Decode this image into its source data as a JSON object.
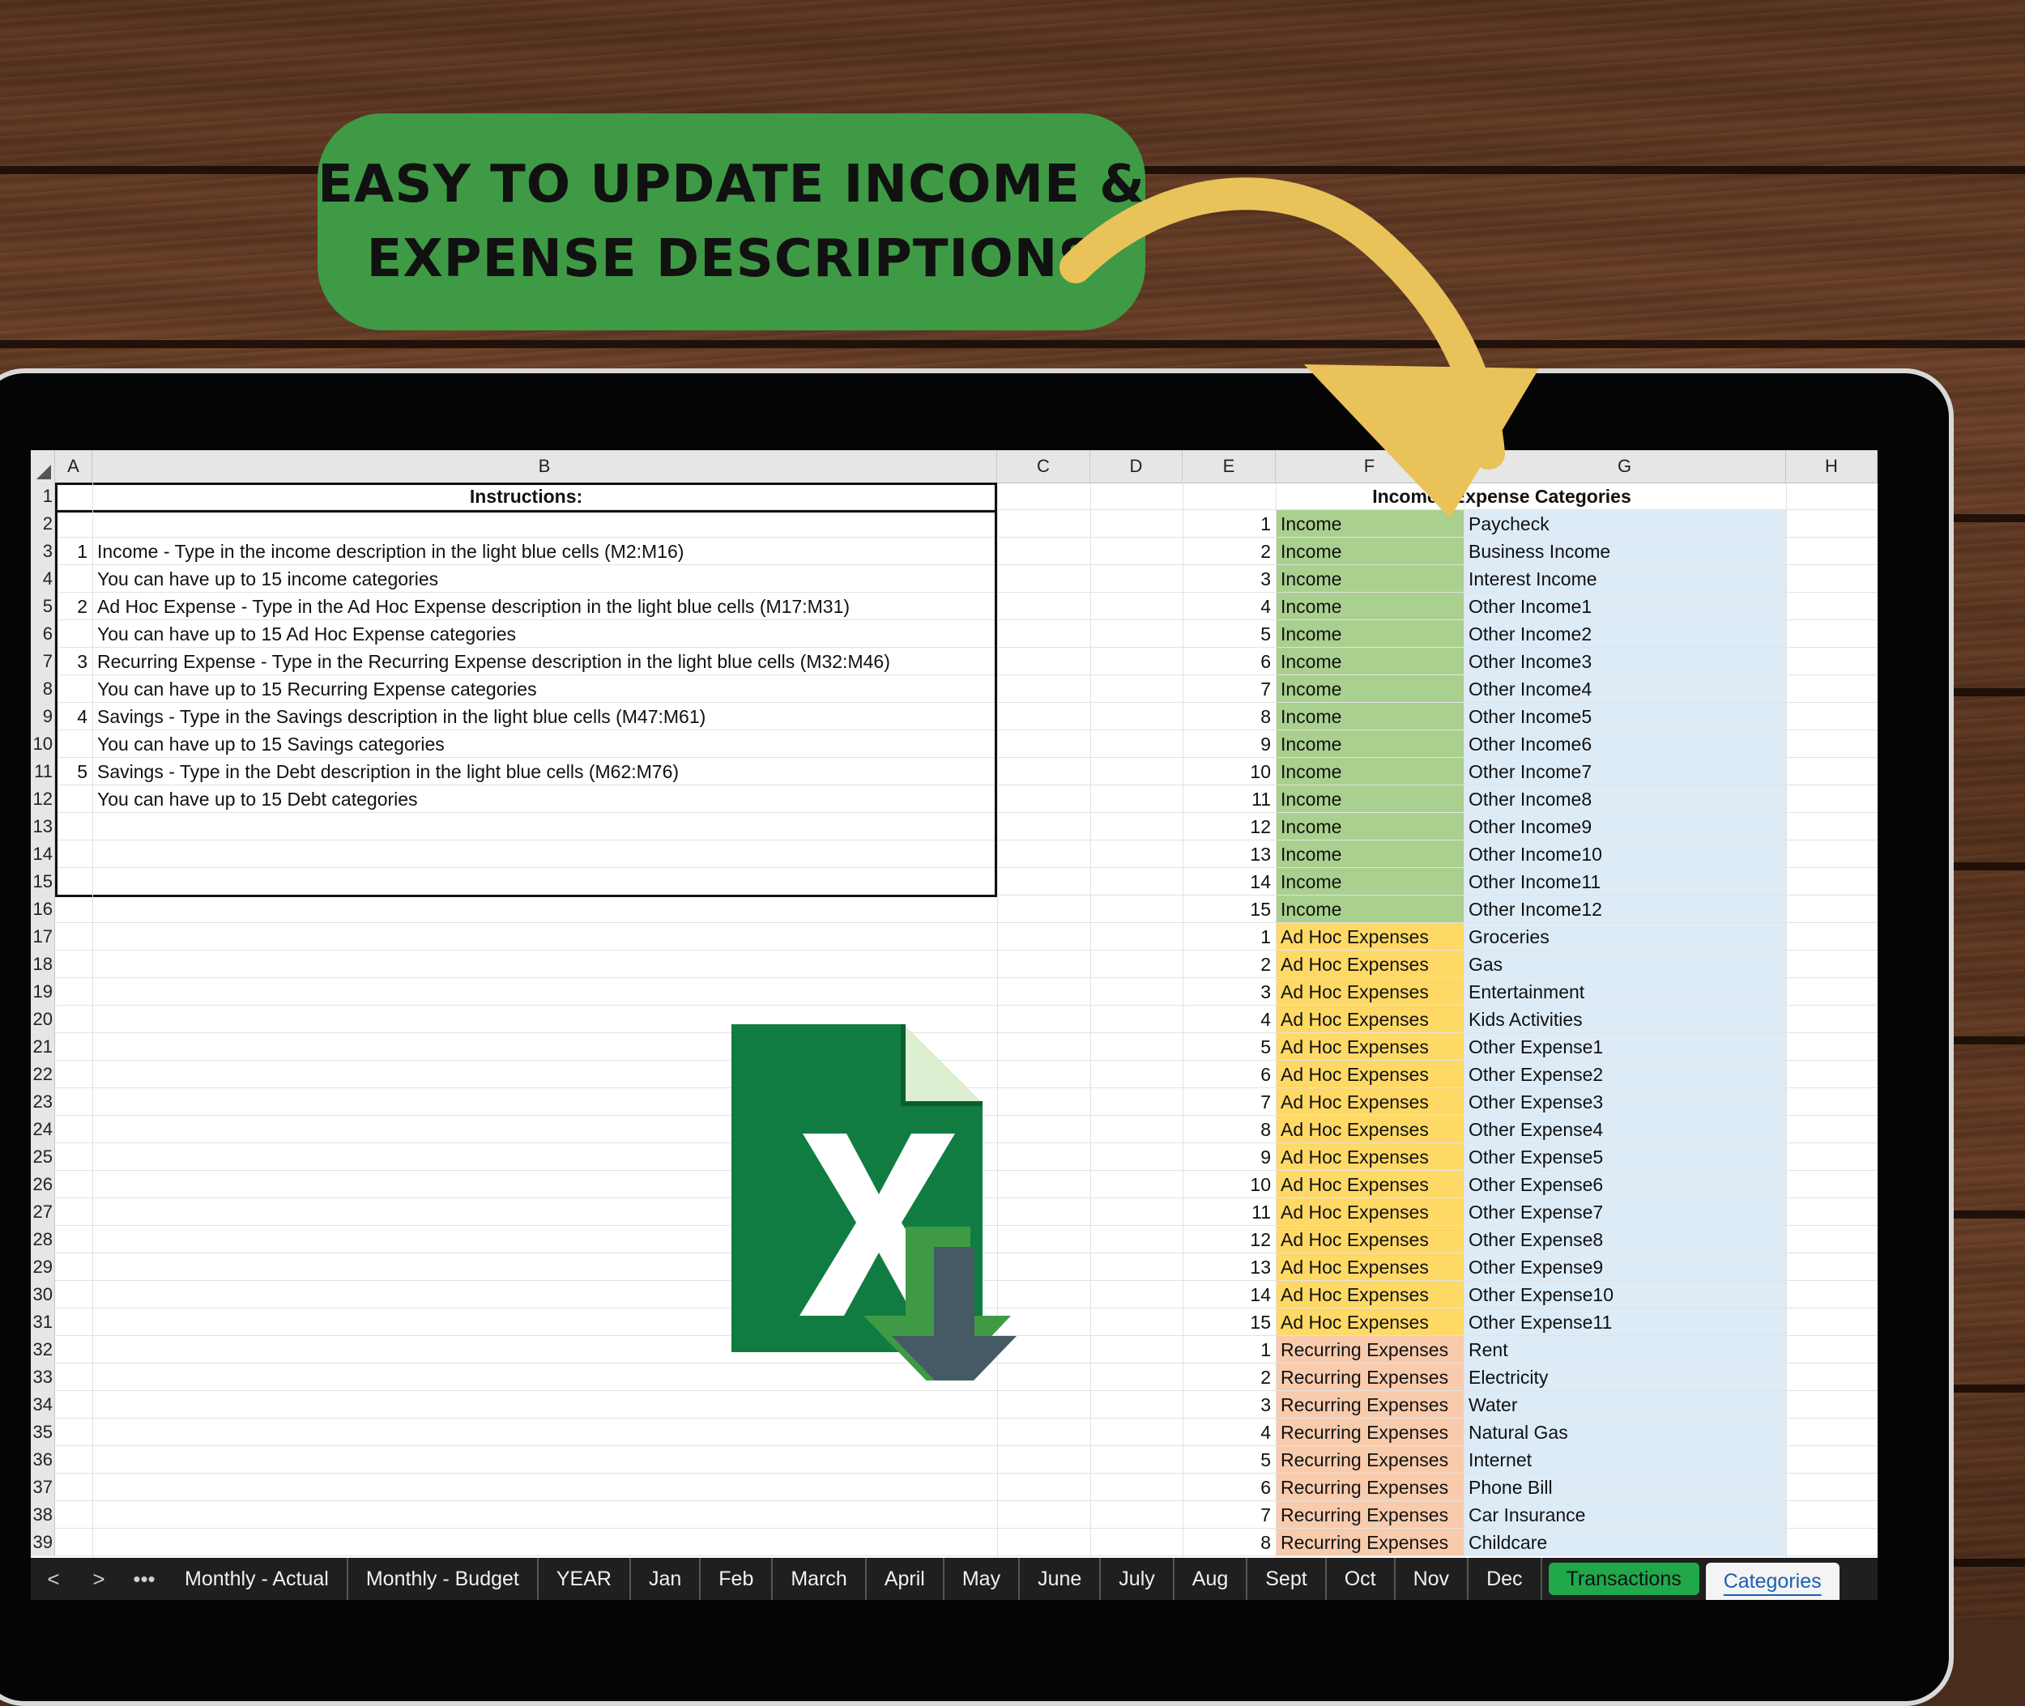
{
  "banner": {
    "line1": "EASY TO UPDATE INCOME &",
    "line2": "EXPENSE DESCRIPTIONS"
  },
  "columns": [
    "A",
    "B",
    "C",
    "D",
    "E",
    "F",
    "G",
    "H"
  ],
  "instructions": {
    "title": "Instructions:",
    "lines": [
      {
        "row": 3,
        "num": "1",
        "text": "Income - Type in the income description in the light blue cells (M2:M16)"
      },
      {
        "row": 4,
        "num": "",
        "text": "You can have up to 15 income categories"
      },
      {
        "row": 5,
        "num": "2",
        "text": "Ad Hoc Expense - Type in the Ad Hoc Expense description in the light blue cells (M17:M31)"
      },
      {
        "row": 6,
        "num": "",
        "text": "You can have up to 15 Ad Hoc Expense categories"
      },
      {
        "row": 7,
        "num": "3",
        "text": "Recurring Expense - Type in the Recurring Expense description in the light blue cells (M32:M46)"
      },
      {
        "row": 8,
        "num": "",
        "text": "You can have up to 15 Recurring Expense categories"
      },
      {
        "row": 9,
        "num": "4",
        "text": "Savings - Type in the Savings description in the light blue cells (M47:M61)"
      },
      {
        "row": 10,
        "num": "",
        "text": "You can have up to 15 Savings categories"
      },
      {
        "row": 11,
        "num": "5",
        "text": "Savings - Type in the Debt description in the light blue cells (M62:M76)"
      },
      {
        "row": 12,
        "num": "",
        "text": "You can have up to 15 Debt categories"
      }
    ]
  },
  "categories": {
    "title": "Income / Expense Categories",
    "rows": [
      {
        "n": "1",
        "type": "Income",
        "desc": "Paycheck"
      },
      {
        "n": "2",
        "type": "Income",
        "desc": "Business Income"
      },
      {
        "n": "3",
        "type": "Income",
        "desc": "Interest Income"
      },
      {
        "n": "4",
        "type": "Income",
        "desc": "Other Income1"
      },
      {
        "n": "5",
        "type": "Income",
        "desc": "Other Income2"
      },
      {
        "n": "6",
        "type": "Income",
        "desc": "Other Income3"
      },
      {
        "n": "7",
        "type": "Income",
        "desc": "Other Income4"
      },
      {
        "n": "8",
        "type": "Income",
        "desc": "Other Income5"
      },
      {
        "n": "9",
        "type": "Income",
        "desc": "Other Income6"
      },
      {
        "n": "10",
        "type": "Income",
        "desc": "Other Income7"
      },
      {
        "n": "11",
        "type": "Income",
        "desc": "Other Income8"
      },
      {
        "n": "12",
        "type": "Income",
        "desc": "Other Income9"
      },
      {
        "n": "13",
        "type": "Income",
        "desc": "Other Income10"
      },
      {
        "n": "14",
        "type": "Income",
        "desc": "Other Income11"
      },
      {
        "n": "15",
        "type": "Income",
        "desc": "Other Income12"
      },
      {
        "n": "1",
        "type": "Ad Hoc Expenses",
        "desc": "Groceries"
      },
      {
        "n": "2",
        "type": "Ad Hoc Expenses",
        "desc": "Gas"
      },
      {
        "n": "3",
        "type": "Ad Hoc Expenses",
        "desc": "Entertainment"
      },
      {
        "n": "4",
        "type": "Ad Hoc Expenses",
        "desc": "Kids Activities"
      },
      {
        "n": "5",
        "type": "Ad Hoc Expenses",
        "desc": "Other Expense1"
      },
      {
        "n": "6",
        "type": "Ad Hoc Expenses",
        "desc": "Other Expense2"
      },
      {
        "n": "7",
        "type": "Ad Hoc Expenses",
        "desc": "Other Expense3"
      },
      {
        "n": "8",
        "type": "Ad Hoc Expenses",
        "desc": "Other Expense4"
      },
      {
        "n": "9",
        "type": "Ad Hoc Expenses",
        "desc": "Other Expense5"
      },
      {
        "n": "10",
        "type": "Ad Hoc Expenses",
        "desc": "Other Expense6"
      },
      {
        "n": "11",
        "type": "Ad Hoc Expenses",
        "desc": "Other Expense7"
      },
      {
        "n": "12",
        "type": "Ad Hoc Expenses",
        "desc": "Other Expense8"
      },
      {
        "n": "13",
        "type": "Ad Hoc Expenses",
        "desc": "Other Expense9"
      },
      {
        "n": "14",
        "type": "Ad Hoc Expenses",
        "desc": "Other Expense10"
      },
      {
        "n": "15",
        "type": "Ad Hoc Expenses",
        "desc": "Other Expense11"
      },
      {
        "n": "1",
        "type": "Recurring Expenses",
        "desc": "Rent"
      },
      {
        "n": "2",
        "type": "Recurring Expenses",
        "desc": "Electricity"
      },
      {
        "n": "3",
        "type": "Recurring Expenses",
        "desc": "Water"
      },
      {
        "n": "4",
        "type": "Recurring Expenses",
        "desc": "Natural Gas"
      },
      {
        "n": "5",
        "type": "Recurring Expenses",
        "desc": "Internet"
      },
      {
        "n": "6",
        "type": "Recurring Expenses",
        "desc": "Phone Bill"
      },
      {
        "n": "7",
        "type": "Recurring Expenses",
        "desc": "Car Insurance"
      },
      {
        "n": "8",
        "type": "Recurring Expenses",
        "desc": "Childcare"
      }
    ]
  },
  "tabs": {
    "prev": "<",
    "next": ">",
    "more": "•••",
    "items": [
      {
        "label": "Monthly - Actual",
        "state": "normal"
      },
      {
        "label": "Monthly - Budget",
        "state": "normal"
      },
      {
        "label": "YEAR",
        "state": "normal"
      },
      {
        "label": "Jan",
        "state": "normal"
      },
      {
        "label": "Feb",
        "state": "normal"
      },
      {
        "label": "March",
        "state": "normal"
      },
      {
        "label": "April",
        "state": "normal"
      },
      {
        "label": "May",
        "state": "normal"
      },
      {
        "label": "June",
        "state": "normal"
      },
      {
        "label": "July",
        "state": "normal"
      },
      {
        "label": "Aug",
        "state": "normal"
      },
      {
        "label": "Sept",
        "state": "normal"
      },
      {
        "label": "Oct",
        "state": "normal"
      },
      {
        "label": "Nov",
        "state": "normal"
      },
      {
        "label": "Dec",
        "state": "normal"
      },
      {
        "label": "Transactions",
        "state": "green"
      },
      {
        "label": "Categories",
        "state": "active"
      }
    ]
  },
  "colors": {
    "banner": "#3f9a45",
    "arrow": "#e9c25a",
    "income": "#a9d08e",
    "adhoc": "#ffd966",
    "recurring": "#f8cbad",
    "description": "#ddebf7",
    "excel_green": "#107c41"
  },
  "icons": {
    "excel": "excel-download-icon",
    "arrow": "curved-arrow-icon"
  }
}
